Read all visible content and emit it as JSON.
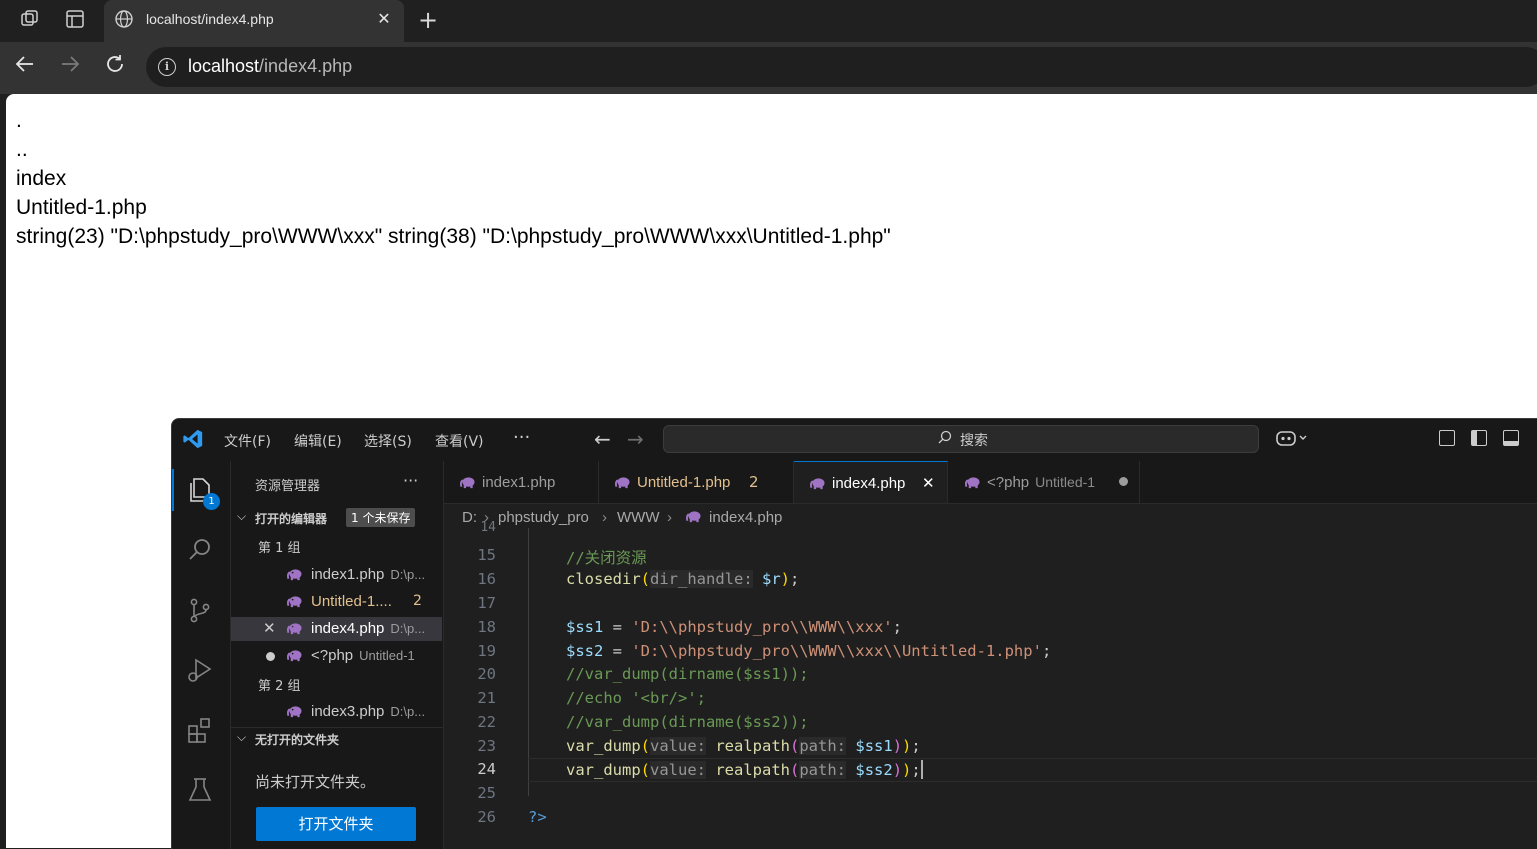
{
  "browser": {
    "tab_title": "localhost/index4.php",
    "url_host": "localhost",
    "url_path": "/index4.php"
  },
  "page": {
    "lines": [
      ".",
      "..",
      "index",
      "Untitled-1.php",
      "string(23) \"D:\\phpstudy_pro\\WWW\\xxx\" string(38) \"D:\\phpstudy_pro\\WWW\\xxx\\Untitled-1.php\""
    ]
  },
  "vscode": {
    "menu": [
      "文件(F)",
      "编辑(E)",
      "选择(S)",
      "查看(V)"
    ],
    "more": "···",
    "search_placeholder": "搜索",
    "activity_badge": "1",
    "explorer": {
      "title": "资源管理器",
      "more": "···",
      "open_editors_label": "打开的编辑器",
      "unsaved_badge": "1 个未保存",
      "group1_label": "第 1 组",
      "group2_label": "第 2 组",
      "files_group1": [
        {
          "name": "index1.php",
          "desc": "D:\\p..."
        },
        {
          "name": "Untitled-1....",
          "count": "2"
        },
        {
          "name": "index4.php",
          "desc": "D:\\p..."
        },
        {
          "name": "<?php",
          "desc": "Untitled-1"
        }
      ],
      "files_group2": [
        {
          "name": "index3.php",
          "desc": "D:\\p..."
        }
      ],
      "no_folder_label": "无打开的文件夹",
      "no_folder_text": "尚未打开文件夹。",
      "open_folder_button": "打开文件夹"
    },
    "tabs": [
      {
        "label": "index1.php"
      },
      {
        "label": "Untitled-1.php",
        "count": "2"
      },
      {
        "label": "index4.php"
      },
      {
        "label": "<?php",
        "desc": "Untitled-1"
      }
    ],
    "breadcrumb": [
      "D:",
      "phpstudy_pro",
      "WWW",
      "index4.php"
    ],
    "line_numbers": [
      "14",
      "15",
      "16",
      "17",
      "18",
      "19",
      "20",
      "21",
      "22",
      "23",
      "24",
      "25",
      "26"
    ],
    "code": {
      "l15": "//关闭资源",
      "l16_fn": "closedir",
      "l16_hint": "dir_handle:",
      "l16_var": "$r",
      "l18_var": "$ss1",
      "l18_str": "'D:\\\\phpstudy_pro\\\\WWW\\\\xxx'",
      "l19_var": "$ss2",
      "l19_str": "'D:\\\\phpstudy_pro\\\\WWW\\\\xxx\\\\Untitled-1.php'",
      "l20": "//var_dump(dirname($ss1));",
      "l21": "//echo '<br/>';",
      "l22": "//var_dump(dirname($ss2));",
      "vd": "var_dump",
      "hint_value": "value:",
      "rp": "realpath",
      "hint_path": "path:",
      "l23_var": "$ss1",
      "l24_var": "$ss2",
      "l26": "?>"
    }
  }
}
